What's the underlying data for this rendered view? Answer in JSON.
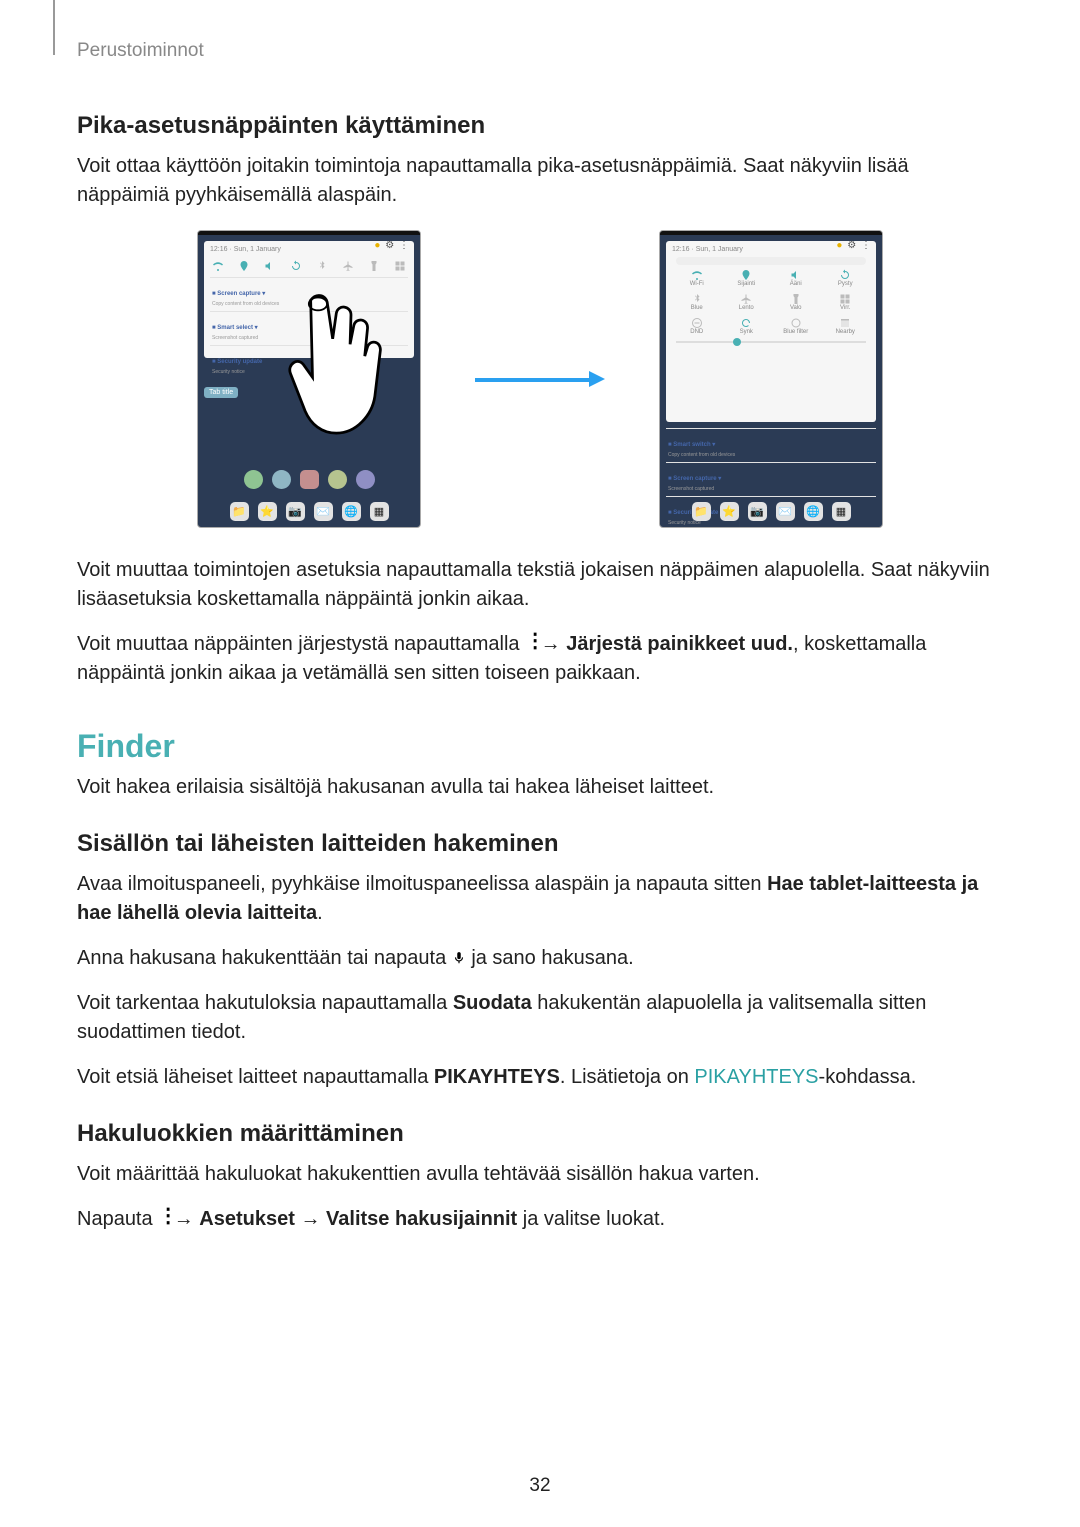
{
  "header": {
    "breadcrumb": "Perustoiminnot"
  },
  "section1": {
    "title": "Pika-asetusnäppäinten käyttäminen",
    "p1": "Voit ottaa käyttöön joitakin toimintoja napauttamalla pika-asetusnäppäimiä. Saat näkyviin lisää näppäimiä pyyhkäisemällä alaspäin.",
    "p2": "Voit muuttaa toimintojen asetuksia napauttamalla tekstiä jokaisen näppäimen alapuolella. Saat näkyviin lisäasetuksia koskettamalla näppäintä jonkin aikaa.",
    "p3_a": "Voit muuttaa näppäinten järjestystä napauttamalla ",
    "p3_b": " → ",
    "p3_bold": "Järjestä painikkeet uud.",
    "p3_c": ", koskettamalla näppäintä jonkin aikaa ja vetämällä sen sitten toiseen paikkaan."
  },
  "finder": {
    "title": "Finder",
    "intro": "Voit hakea erilaisia sisältöjä hakusanan avulla tai hakea läheiset laitteet.",
    "sub1": {
      "title": "Sisällön tai läheisten laitteiden hakeminen",
      "p1_a": "Avaa ilmoituspaneeli, pyyhkäise ilmoituspaneelissa alaspäin ja napauta sitten ",
      "p1_bold": "Hae tablet-laitteesta ja hae lähellä olevia laitteita",
      "p1_b": ".",
      "p2_a": "Anna hakusana hakukenttään tai napauta ",
      "p2_b": " ja sano hakusana.",
      "p3_a": "Voit tarkentaa hakutuloksia napauttamalla ",
      "p3_bold": "Suodata",
      "p3_b": " hakukentän alapuolella ja valitsemalla sitten suodattimen tiedot.",
      "p4_a": "Voit etsiä läheiset laitteet napauttamalla ",
      "p4_bold": "PIKAYHTEYS",
      "p4_b": ". Lisätietoja on ",
      "p4_link": "PIKAYHTEYS",
      "p4_c": "-kohdassa."
    },
    "sub2": {
      "title": "Hakuluokkien määrittäminen",
      "p1": "Voit määrittää hakuluokat hakukenttien avulla tehtävää sisällön hakua varten.",
      "p2_a": "Napauta ",
      "p2_b": " → ",
      "p2_bold1": "Asetukset",
      "p2_c": " → ",
      "p2_bold2": "Valitse hakusijainnit",
      "p2_d": " ja valitse luokat."
    }
  },
  "page_number": "32"
}
